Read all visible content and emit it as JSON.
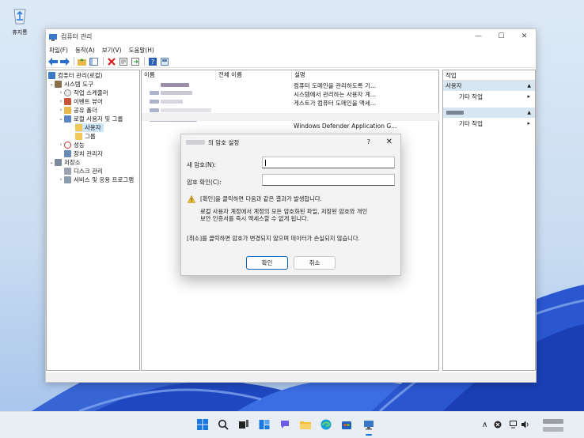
{
  "desktop": {
    "recycle_bin_label": "휴지통"
  },
  "window": {
    "title": "컴퓨터 관리",
    "buttons": {
      "minimize": "—",
      "maximize": "☐",
      "close": "✕"
    },
    "menu": [
      "파일(F)",
      "동작(A)",
      "보기(V)",
      "도움말(H)"
    ]
  },
  "tree": {
    "root": "컴퓨터 관리(로컬)",
    "system_tools": "시스템 도구",
    "task_scheduler": "작업 스케줄러",
    "event_viewer": "이벤트 뷰어",
    "shared_folders": "공유 폴더",
    "local_users_groups": "로컬 사용자 및 그룹",
    "users": "사용자",
    "groups": "그룹",
    "performance": "성능",
    "device_manager": "장치 관리자",
    "storage": "저장소",
    "disk_management": "디스크 관리",
    "services_apps": "서비스 및 응용 프로그램"
  },
  "list": {
    "columns": [
      "이름",
      "전체 이름",
      "설명"
    ],
    "descriptions": [
      "컴퓨터 도메인을 관리하도록 기...",
      "시스템에서 관리하는 사용자 계...",
      "게스트가 컴퓨터 도메인을 액세...",
      "Windows Defender Application G..."
    ]
  },
  "actions": {
    "header": "작업",
    "section1": "사용자",
    "item1": "기타 작업",
    "item2": "기타 작업"
  },
  "dialog": {
    "title": "의 암호 설정",
    "help": "?",
    "close": "✕",
    "new_password_label": "새 암호(N):",
    "confirm_password_label": "암호 확인(C):",
    "warning_line": "[확인]을 클릭하면 다음과 같은 결과가 발생합니다.",
    "detail_line1": "로컬 사용자 계정에서 계정의 모든 암호화된 파일, 저장된 암호와 개인",
    "detail_line2": "보안 인증서를 즉시 액세스할 수 없게 됩니다.",
    "cancel_note": "[취소]를 클릭하면 암호가 변경되지 않으며 데이터가 손실되지 않습니다.",
    "ok_label": "확인",
    "cancel_label": "취소"
  }
}
